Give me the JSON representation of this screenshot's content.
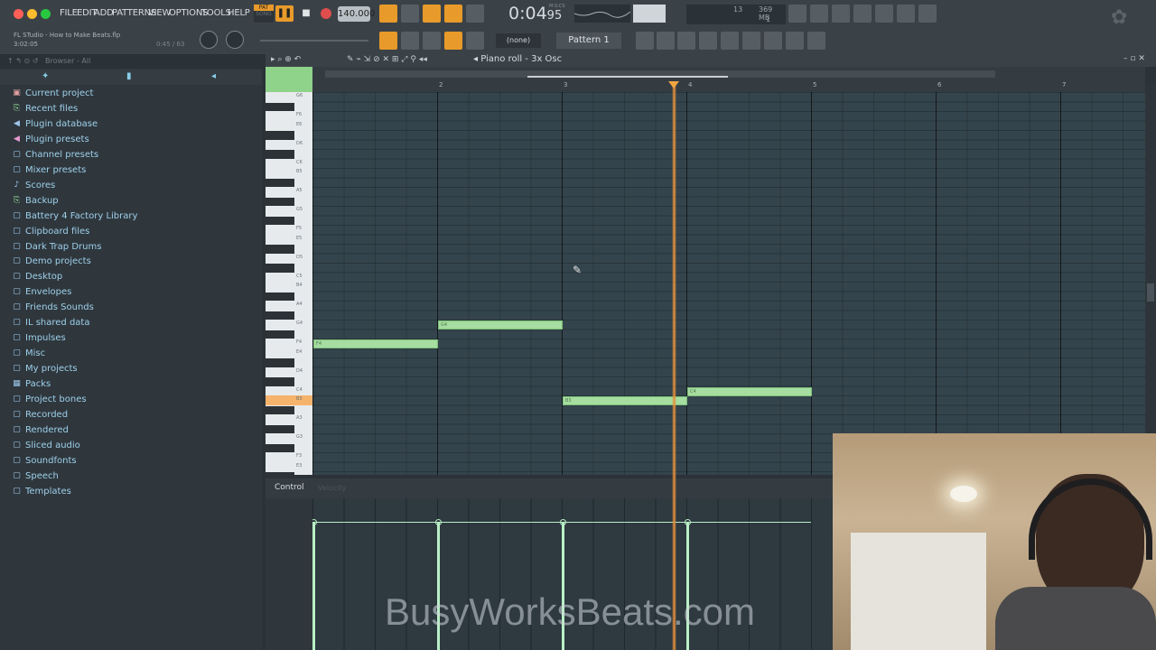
{
  "menu": [
    "FILE",
    "EDIT",
    "ADD",
    "PATTERNS",
    "VIEW",
    "OPTIONS",
    "TOOLS",
    "HELP"
  ],
  "transport": {
    "mode_top": "PAT",
    "mode_bottom": "SONG",
    "tempo": "140.000",
    "time": "0:04",
    "time_sub": "95",
    "time_unit": "M:S:CS"
  },
  "project": {
    "file": "FL STudio - How to Make Beats.flp",
    "time": "3:02:05",
    "info": "0:45 / 63"
  },
  "hint": {
    "cpu": "13",
    "mem": "369 MB",
    "poly": "1"
  },
  "pattern": {
    "selector": "(none)",
    "name": "Pattern 1"
  },
  "browser": {
    "path": "Browser - All",
    "items": [
      {
        "label": "Current project",
        "icon": "project-icon",
        "color": "#e0a0a0"
      },
      {
        "label": "Recent files",
        "icon": "recent-folder-icon",
        "color": "#9be39b"
      },
      {
        "label": "Plugin database",
        "icon": "plugin-icon",
        "color": "#9ec7ea"
      },
      {
        "label": "Plugin presets",
        "icon": "preset-icon",
        "color": "#e79ad1"
      },
      {
        "label": "Channel presets",
        "icon": "channel-icon",
        "color": "#9ec7ea"
      },
      {
        "label": "Mixer presets",
        "icon": "mixer-icon",
        "color": "#9ec7ea"
      },
      {
        "label": "Scores",
        "icon": "score-icon",
        "color": "#9ec7ea"
      },
      {
        "label": "Backup",
        "icon": "backup-folder-icon",
        "color": "#9be39b"
      },
      {
        "label": "Battery 4 Factory Library",
        "icon": "folder-icon",
        "color": "#9ec7ea"
      },
      {
        "label": "Clipboard files",
        "icon": "folder-icon",
        "color": "#9ec7ea"
      },
      {
        "label": "Dark Trap Drums",
        "icon": "folder-icon",
        "color": "#9ec7ea"
      },
      {
        "label": "Demo projects",
        "icon": "folder-icon",
        "color": "#9ec7ea"
      },
      {
        "label": "Desktop",
        "icon": "folder-icon",
        "color": "#9ec7ea"
      },
      {
        "label": "Envelopes",
        "icon": "folder-icon",
        "color": "#9ec7ea"
      },
      {
        "label": "Friends Sounds",
        "icon": "folder-icon",
        "color": "#9ec7ea"
      },
      {
        "label": "IL shared data",
        "icon": "folder-icon",
        "color": "#9ec7ea"
      },
      {
        "label": "Impulses",
        "icon": "folder-icon",
        "color": "#9ec7ea"
      },
      {
        "label": "Misc",
        "icon": "folder-icon",
        "color": "#9ec7ea"
      },
      {
        "label": "My projects",
        "icon": "folder-icon",
        "color": "#9ec7ea"
      },
      {
        "label": "Packs",
        "icon": "packs-icon",
        "color": "#9ec7ea"
      },
      {
        "label": "Project bones",
        "icon": "folder-icon",
        "color": "#9ec7ea"
      },
      {
        "label": "Recorded",
        "icon": "folder-icon",
        "color": "#9ec7ea"
      },
      {
        "label": "Rendered",
        "icon": "folder-icon",
        "color": "#9ec7ea"
      },
      {
        "label": "Sliced audio",
        "icon": "folder-icon",
        "color": "#9ec7ea"
      },
      {
        "label": "Soundfonts",
        "icon": "folder-icon",
        "color": "#9ec7ea"
      },
      {
        "label": "Speech",
        "icon": "folder-icon",
        "color": "#9ec7ea"
      },
      {
        "label": "Templates",
        "icon": "folder-icon",
        "color": "#9ec7ea"
      }
    ]
  },
  "piano_roll": {
    "title": "Piano roll - 3x Osc",
    "bars": [
      "2",
      "3",
      "4",
      "5",
      "6",
      "7"
    ],
    "key_labels": [
      "F6",
      "E6",
      "D6",
      "C6",
      "B5",
      "A5",
      "G5",
      "F5",
      "E5",
      "D5",
      "C5",
      "B4",
      "A4",
      "G4",
      "F4",
      "E4",
      "D4",
      "C4",
      "B3",
      "A3"
    ],
    "notes": [
      {
        "label": "F4",
        "start_bar": 1.0,
        "length_bars": 1.0
      },
      {
        "label": "G4",
        "start_bar": 2.0,
        "length_bars": 1.0
      },
      {
        "label": "B3",
        "start_bar": 3.0,
        "length_bars": 1.0
      },
      {
        "label": "C4",
        "start_bar": 4.0,
        "length_bars": 1.0
      }
    ],
    "playhead_bar": 3.9,
    "control_label": "Control",
    "control_target": "Velocity",
    "velocities": [
      1.0,
      1.0,
      1.0,
      1.0
    ]
  },
  "watermark": "BusyWorksBeats.com",
  "colors": {
    "note": "#a6dda0",
    "playhead": "#e8913a",
    "accent": "#e89a2a",
    "browser_text": "#9ed0ea"
  }
}
